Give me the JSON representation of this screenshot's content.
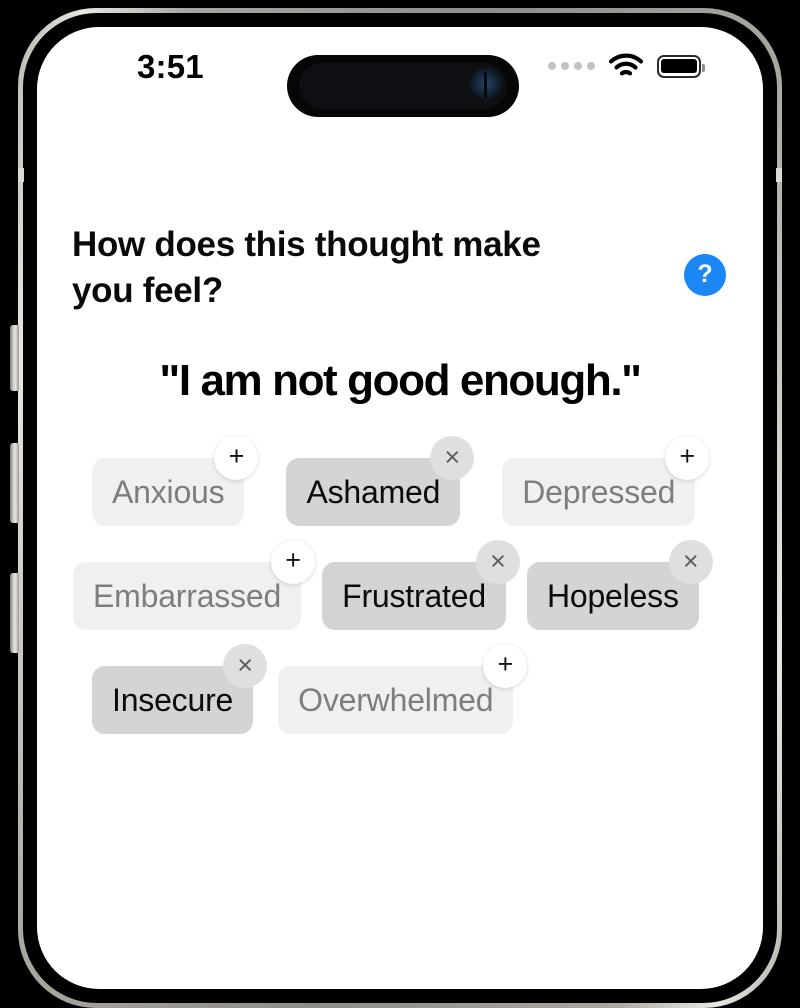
{
  "status_bar": {
    "time": "3:51",
    "cellular_icon": "cellular-dots-icon",
    "wifi_icon": "wifi-icon",
    "battery_icon": "battery-icon"
  },
  "header": {
    "question": "How does this thought make you feel?",
    "help_label": "?",
    "help_icon": "question-mark-icon"
  },
  "thought": {
    "text": "\"I am not good enough.\""
  },
  "colors": {
    "accent_blue": "#1a87f5",
    "chip_unselected_bg": "#f0f0f0",
    "chip_unselected_text": "#7e7e7e",
    "chip_selected_bg": "#d4d4d4",
    "chip_selected_text": "#0b0b0b",
    "badge_add_bg": "#ffffff",
    "badge_remove_bg": "#dfdfdf",
    "screen_bg": "#ffffff",
    "frame_metal": "#a8a69f"
  },
  "badges": {
    "add_glyph": "+",
    "remove_glyph": "×",
    "add_icon": "plus-icon",
    "remove_icon": "close-icon"
  },
  "emotions": {
    "rows": [
      [
        {
          "label": "Anxious",
          "selected": false
        },
        {
          "label": "Ashamed",
          "selected": true
        },
        {
          "label": "Depressed",
          "selected": false
        }
      ],
      [
        {
          "label": "Embarrassed",
          "selected": false
        },
        {
          "label": "Frustrated",
          "selected": true
        },
        {
          "label": "Hopeless",
          "selected": true
        }
      ],
      [
        {
          "label": "Insecure",
          "selected": true
        },
        {
          "label": "Overwhelmed",
          "selected": false
        }
      ]
    ]
  }
}
